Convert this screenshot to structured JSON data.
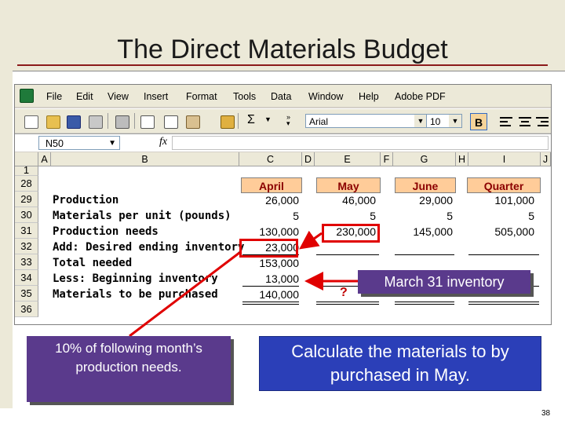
{
  "slide": {
    "title": "The Direct Materials Budget",
    "page_number": "38"
  },
  "spreadsheet": {
    "menu": [
      "File",
      "Edit",
      "View",
      "Insert",
      "Format",
      "Tools",
      "Data",
      "Window",
      "Help",
      "Adobe PDF"
    ],
    "toolbar": {
      "sigma": "Σ",
      "font_name": "Arial",
      "font_size": "10",
      "bold_label": "B"
    },
    "name_box": "N50",
    "fx_label": "fx",
    "columns": [
      "A",
      "B",
      "C",
      "D",
      "E",
      "F",
      "G",
      "H",
      "I",
      "J"
    ],
    "rows": [
      "1",
      "28",
      "29",
      "30",
      "31",
      "32",
      "33",
      "34",
      "35",
      "36"
    ],
    "period_headers": [
      "April",
      "May",
      "June",
      "Quarter"
    ],
    "labels": [
      "Production",
      "Materials per unit (pounds)",
      "Production needs",
      "Add: Desired ending inventory",
      "Total needed",
      "Less: Beginning inventory",
      "Materials to be purchased"
    ],
    "values": {
      "april": [
        "26,000",
        "5",
        "130,000",
        "23,000",
        "153,000",
        "13,000",
        "140,000"
      ],
      "may": [
        "46,000",
        "5",
        "230,000"
      ],
      "june": [
        "29,000",
        "5",
        "145,000"
      ],
      "quarter": [
        "101,000",
        "5",
        "505,000"
      ]
    },
    "question_mark": "?"
  },
  "callouts": {
    "march_inventory": "March 31 inventory",
    "ten_percent": "10% of following month’s production needs.",
    "calculate": "Calculate the materials to by purchased in May."
  },
  "colors": {
    "header_fill": "#ffcc99",
    "header_text": "#8b0000",
    "highlight": "#e00000",
    "callout_purple": "#5a3a8c",
    "callout_blue": "#2b3fb8"
  }
}
